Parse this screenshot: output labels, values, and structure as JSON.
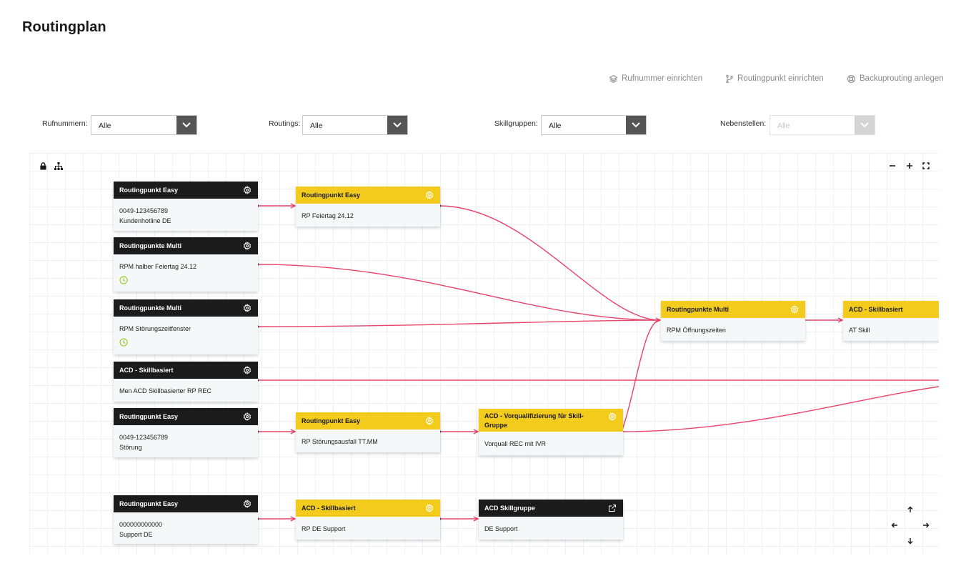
{
  "page": {
    "title": "Routingplan"
  },
  "actions": {
    "rufnummer": "Rufnummer einrichten",
    "routingpunkt": "Routingpunkt einrichten",
    "backup": "Backuprouting anlegen"
  },
  "filters": {
    "rufnummern": {
      "label": "Rufnummern:",
      "value": "Alle"
    },
    "routings": {
      "label": "Routings:",
      "value": "Alle"
    },
    "skillgruppen": {
      "label": "Skillgruppen:",
      "value": "Alle"
    },
    "nebenstellen": {
      "label": "Nebenstellen:",
      "value": "Alle",
      "disabled": true
    }
  },
  "canvas": {
    "controls": [
      "lock-icon",
      "hierarchy-icon",
      "minus-icon",
      "plus-icon",
      "fullscreen-icon"
    ],
    "pan": [
      "arrow-up-icon",
      "arrow-left-icon",
      "arrow-right-icon",
      "arrow-down-icon"
    ],
    "edge_color": "#e8436a"
  },
  "nodes": {
    "n1": {
      "title": "Routingpunkt Easy",
      "line1": "0049-123456789",
      "line2": "Kundenhotline DE"
    },
    "n2": {
      "title": "Routingpunkte Multi",
      "line1": "RPM halber Feiertag 24.12"
    },
    "n3": {
      "title": "Routingpunkte Multi",
      "line1": "RPM Störungszeitfenster"
    },
    "n4": {
      "title": "ACD - Skillbasiert",
      "line1": "Men ACD Skillbasierter RP REC"
    },
    "n5": {
      "title": "Routingpunkt Easy",
      "line1": "0049-123456789",
      "line2": "Störung"
    },
    "n6": {
      "title": "Routingpunkt Easy",
      "line1": "000000000000",
      "line2": "Support DE"
    },
    "y1": {
      "title": "Routingpunkt Easy",
      "line1": "RP Feiertag 24.12"
    },
    "y2": {
      "title": "Routingpunkt Easy",
      "line1": "RP Störungsausfall TT.MM"
    },
    "y3": {
      "title": "ACD - Skillbasiert",
      "line1": "RP DE Support"
    },
    "v1": {
      "title": "ACD - Vorqualifizierung für Skill-Gruppe",
      "line1": "Vorquali REC mit IVR"
    },
    "s1": {
      "title": "ACD Skillgruppe",
      "line1": "DE Support"
    },
    "m1": {
      "title": "Routingpunkte Multi",
      "line1": "RPM Öffnungszeiten"
    },
    "a1": {
      "title": "ACD - Skillbasiert",
      "line1": "AT Skill"
    }
  },
  "colors": {
    "yellow": "#f2cb1d",
    "black": "#1b1b1b",
    "edge": "#e8436a",
    "accent_clock": "#9acd32"
  }
}
